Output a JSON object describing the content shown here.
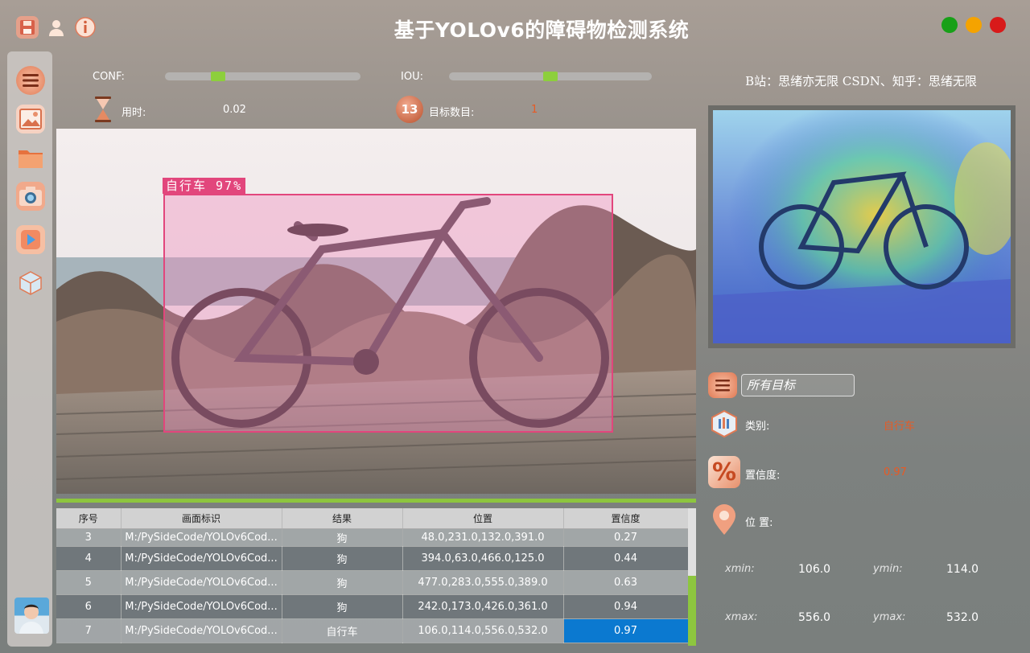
{
  "title": "基于YOLOv6的障碍物检测系统",
  "title_icons": [
    "save-icon",
    "user-icon",
    "info-icon"
  ],
  "window_buttons": {
    "colors": [
      "#18a018",
      "#f5a300",
      "#d81a1a"
    ]
  },
  "sidebar": {
    "items": [
      "menu-icon",
      "image-icon",
      "folder-icon",
      "camera-icon",
      "video-icon",
      "model-icon"
    ]
  },
  "controls": {
    "conf_label": "CONF:",
    "conf_value": 0.25,
    "iou_label": "IOU:",
    "iou_value": 0.5,
    "time_label": "用时:",
    "time_value": "0.02",
    "count_label": "目标数目:",
    "count_value": "1",
    "count_badge": "13"
  },
  "detection": {
    "label": "自行车 97%",
    "box_color": "#e2467c"
  },
  "table": {
    "headers": [
      "序号",
      "画面标识",
      "结果",
      "位置",
      "置信度"
    ],
    "rows": [
      [
        "3",
        "M:/PySideCode/YOLOv6Cod...",
        "狗",
        "48.0,231.0,132.0,391.0",
        "0.27"
      ],
      [
        "4",
        "M:/PySideCode/YOLOv6Cod...",
        "狗",
        "394.0,63.0,466.0,125.0",
        "0.44"
      ],
      [
        "5",
        "M:/PySideCode/YOLOv6Cod...",
        "狗",
        "477.0,283.0,555.0,389.0",
        "0.63"
      ],
      [
        "6",
        "M:/PySideCode/YOLOv6Cod...",
        "狗",
        "242.0,173.0,426.0,361.0",
        "0.94"
      ],
      [
        "7",
        "M:/PySideCode/YOLOv6Cod...",
        "自行车",
        "106.0,114.0,556.0,532.0",
        "0.97"
      ]
    ]
  },
  "right_panel": {
    "credit": "B站：思绪亦无限  CSDN、知乎：思绪无限",
    "target_select": "所有目标",
    "class_label": "类别:",
    "class_value": "自行车",
    "conf_label": "置信度:",
    "conf_value": "0.97",
    "pos_label": "位 置:",
    "xmin_label": "xmin:",
    "xmin_value": "106.0",
    "ymin_label": "ymin:",
    "ymin_value": "114.0",
    "xmax_label": "xmax:",
    "xmax_value": "556.0",
    "ymax_label": "ymax:",
    "ymax_value": "532.0"
  }
}
